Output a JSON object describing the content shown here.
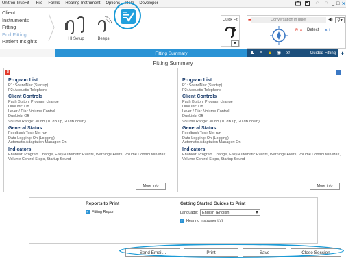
{
  "menubar": {
    "app": "Unitron TrueFit",
    "items": [
      "File",
      "Forms",
      "Hearing Instrument",
      "Options",
      "Help",
      "Developer"
    ]
  },
  "nav": {
    "items": [
      {
        "label": "Client",
        "active": false
      },
      {
        "label": "Instruments",
        "active": false
      },
      {
        "label": "Fitting",
        "active": false
      },
      {
        "label": "End Fitting",
        "active": true
      },
      {
        "label": "Patient Insights",
        "active": false
      }
    ]
  },
  "tools": {
    "hi_setup": "HI Setup",
    "beeps": "Beeps"
  },
  "quickfit": {
    "label": "Quick Fit"
  },
  "rightpanel": {
    "conversation": "Conversation in quiet",
    "detect": "Detect",
    "r_mark": "R ✕",
    "l_mark": "✕ L"
  },
  "bluebar": {
    "title": "Fitting Summary",
    "guided": "Guided Fitting",
    "plus": "+"
  },
  "page": {
    "title": "Fitting Summary"
  },
  "summary": {
    "left": {
      "badge": "R",
      "program_list_title": "Program List",
      "programs": [
        "P1: SoundNav (Startup)",
        "P2: Acoustic Telephone"
      ],
      "client_controls_title": "Client Controls",
      "client_controls": [
        "Push Button: Program change",
        "DuoLink: On",
        "Lever / Dial: Volume Control",
        "DuoLink: Off",
        "Volume Range: 30 dB (10 dB up, 20 dB down)"
      ],
      "general_status_title": "General Status",
      "general_status": [
        "Feedback Test: Not run",
        "Data Logging: On (Logging)",
        "Automatic Adaptation Manager: On"
      ],
      "indicators_title": "Indicators",
      "indicators": "Enabled: Program Change, Easy/Automatic Events, Warnings/Alerts, Volume Control Min/Max, Volume Control Steps, Startup Sound",
      "more_info": "More info"
    },
    "right": {
      "badge": "L",
      "program_list_title": "Program List",
      "programs": [
        "P1: SoundNav (Startup)",
        "P2: Acoustic Telephone"
      ],
      "client_controls_title": "Client Controls",
      "client_controls": [
        "Push Button: Program change",
        "DuoLink: On",
        "Lever / Dial: Volume Control",
        "DuoLink: Off",
        "Volume Range: 30 dB (10 dB up, 20 dB down)"
      ],
      "general_status_title": "General Status",
      "general_status": [
        "Feedback Test: Not run",
        "Data Logging: On (Logging)",
        "Automatic Adaptation Manager: On"
      ],
      "indicators_title": "Indicators",
      "indicators": "Enabled: Program Change, Easy/Automatic Events, Warnings/Alerts, Volume Control Min/Max, Volume Control Steps, Startup Sound",
      "more_info": "More info"
    }
  },
  "print": {
    "reports_title": "Reports to Print",
    "fitting_report": "Fitting Report",
    "guides_title": "Getting Started Guides to Print",
    "language_label": "Language:",
    "language_value": "English (English)",
    "hearing_instruments": "Hearing Instrument(s)"
  },
  "buttons": {
    "send_email": "Send Email...",
    "print": "Print",
    "save": "Save",
    "close_session": "Close Session"
  },
  "colors": {
    "accent": "#2a93d5",
    "right_ear": "#e23a2b",
    "left_ear": "#3b78c4",
    "dark_bar": "#1c4f7c"
  }
}
